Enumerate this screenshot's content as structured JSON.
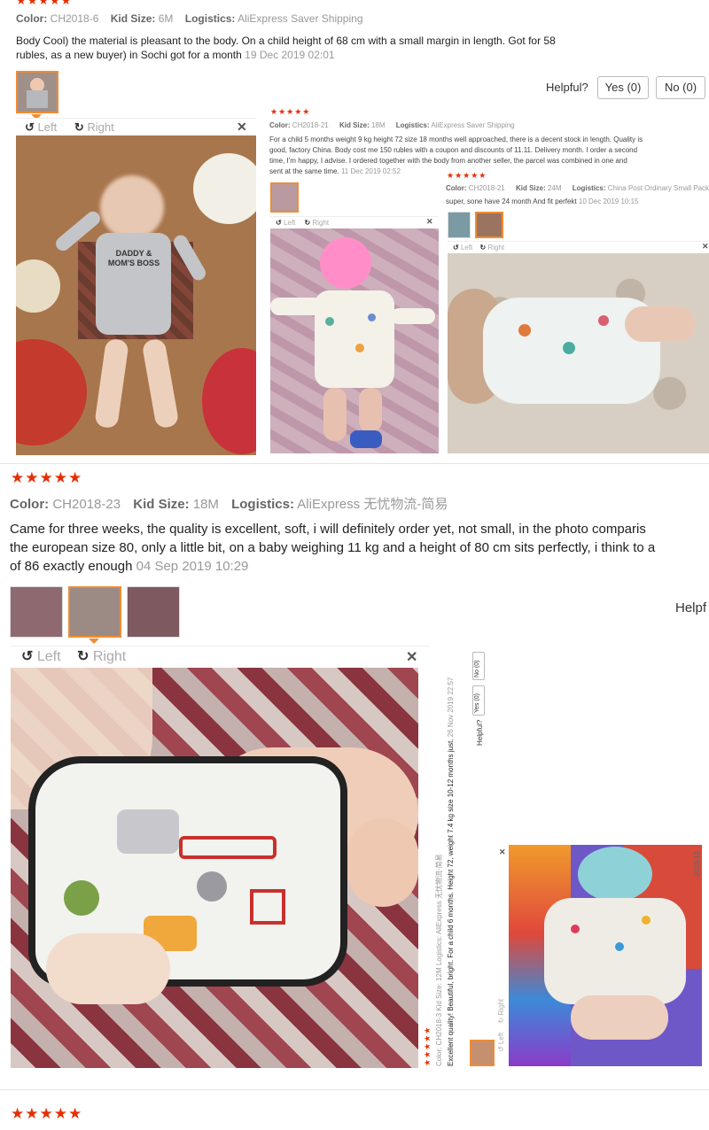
{
  "review1": {
    "stars": "★★★★★",
    "color_label": "Color:",
    "color_value": "CH2018-6",
    "size_label": "Kid Size:",
    "size_value": "6M",
    "logistics_label": "Logistics:",
    "logistics_value": "AliExpress Saver Shipping",
    "text_line1": "Body Cool) the material is pleasant to the body. On a child height of 68 cm with a small margin in length. Got for 58",
    "text_line2": "rubles, as a new buyer) in Sochi got for a month",
    "date": "19 Dec 2019 02:01",
    "helpful_label": "Helpful?",
    "yes_label": "Yes (0)",
    "no_label": "No (0)",
    "left_label": "Left",
    "right_label": "Right",
    "shirt_text": "DADDY & MOM'S BOSS"
  },
  "embedded2": {
    "stars": "★★★★★",
    "color_label": "Color:",
    "color_value": "CH2018-21",
    "size_label": "Kid Size:",
    "size_value": "18M",
    "logistics_label": "Logistics:",
    "logistics_value": "AliExpress Saver Shipping",
    "text_line1": "For a child 5 months weight 9 kg height 72 size 18 months well approached, there is a decent stock in length. Quality is",
    "text_line2": "good, factory China. Body cost me 150 rubles with a coupon and discounts of 11.11. Delivery month. I order a second",
    "text_line3": "time, I'm happy, I advise. I ordered together with the body from another seller, the parcel was combined in one and",
    "text_line4": "sent at the same time.",
    "date": "11 Dec 2019 02:52",
    "left_label": "Left",
    "right_label": "Right"
  },
  "embedded3": {
    "stars": "★★★★★",
    "color_label": "Color:",
    "color_value": "CH2018-21",
    "size_label": "Kid Size:",
    "size_value": "24M",
    "logistics_label": "Logistics:",
    "logistics_value": "China Post Ordinary Small Packet Pl",
    "text": "super, sone have 24 month And fit perfekt",
    "date": "10 Dec 2019 10:15",
    "left_label": "Left",
    "right_label": "Right"
  },
  "review4": {
    "stars": "★★★★★",
    "color_label": "Color:",
    "color_value": "CH2018-23",
    "size_label": "Kid Size:",
    "size_value": "18M",
    "logistics_label": "Logistics:",
    "logistics_value": "AliExpress 无忧物流-简易",
    "text_line1": "Came for three weeks, the quality is excellent, soft, i will definitely order yet, not small, in the photo comparis",
    "text_line2": "the european size 80, only a little bit, on a baby weighing 11 kg and a height of 80 cm sits perfectly, i think to a",
    "text_line3": "of 86 exactly enough",
    "date": "04 Sep 2019 10:29",
    "helpful_label": "Helpf",
    "left_label": "Left",
    "right_label": "Right"
  },
  "embedded5": {
    "stars": "★★★★★",
    "meta": "Color: CH2018-3    Kid Size: 12M    Logistics: AliExpress 无忧物流-简易",
    "text": "Excellent quality! Beautiful, bright. For a child 6 months. Height 72, weight 7.4 kg size 10-12 months just.",
    "date": "26 Nov 2019 22:57",
    "helpful_label": "Helpful?",
    "yes_label": "Yes (0)",
    "no_label": "No (0)",
    "left_label": "Left",
    "right_label": "Right",
    "side_date": "2019.12"
  },
  "review6": {
    "stars": "★★★★★"
  },
  "colors": {
    "star": "#e62e04",
    "selected_border": "#f08c33"
  },
  "icons": [
    "rotate-left-icon",
    "rotate-right-icon",
    "close-icon"
  ]
}
